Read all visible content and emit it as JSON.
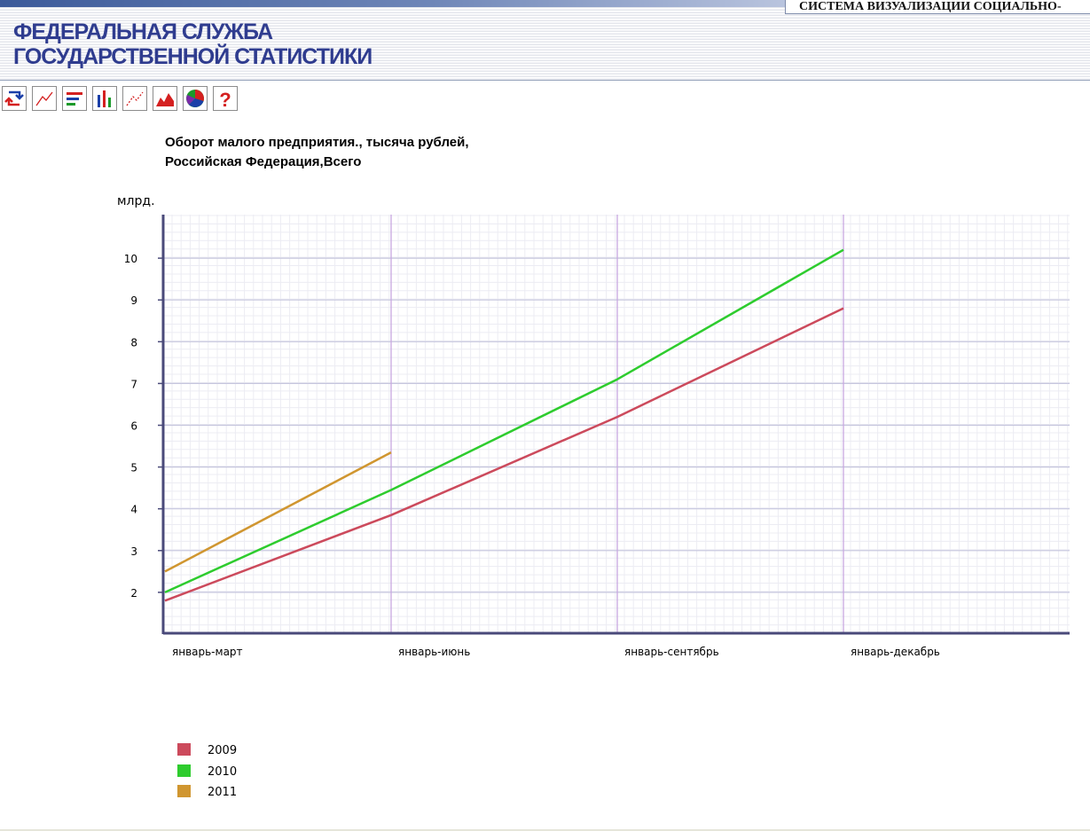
{
  "header": {
    "system_title": "СИСТЕМА ВИЗУАЛИЗАЦИИ СОЦИАЛЬНО-",
    "org_name_line1": "ФЕДЕРАЛЬНАЯ СЛУЖБА",
    "org_name_line2": "ГОСУДАРСТВЕННОЙ СТАТИСТИКИ"
  },
  "toolbar": {
    "buttons": [
      {
        "icon": "swap-axes-icon"
      },
      {
        "icon": "line-chart-icon"
      },
      {
        "icon": "horizontal-bar-chart-icon"
      },
      {
        "icon": "vertical-bar-chart-icon"
      },
      {
        "icon": "dotted-line-chart-icon"
      },
      {
        "icon": "area-chart-icon"
      },
      {
        "icon": "pie-chart-icon"
      },
      {
        "icon": "help-icon",
        "label": "?"
      }
    ]
  },
  "colors": {
    "axis": "#4a4a7a",
    "major_grid": "#c6c6de",
    "minor_grid": "#ececf3",
    "category_grid": "#c8a8e0",
    "org_name": "#2f3c8f"
  },
  "chart_data": {
    "type": "line",
    "title_line1": "Оборот малого  предприятия., тысяча рублей,",
    "title_line2": "Российская Федерация,Всего",
    "unit_label": "млрд.",
    "categories": [
      "январь-март",
      "январь-июнь",
      "январь-сентябрь",
      "январь-декабрь"
    ],
    "y_ticks": [
      2,
      3,
      4,
      5,
      6,
      7,
      8,
      9,
      10
    ],
    "ylim": [
      1,
      11
    ],
    "grid": true,
    "legend_position": "bottom-left",
    "series": [
      {
        "name": "2009",
        "color": "#cc4a5c",
        "values": [
          1.8,
          3.85,
          6.2,
          8.8
        ]
      },
      {
        "name": "2010",
        "color": "#2ecc2e",
        "values": [
          2.0,
          4.45,
          7.1,
          10.2
        ]
      },
      {
        "name": "2011",
        "color": "#d09630",
        "values": [
          2.5,
          5.35
        ]
      }
    ]
  }
}
